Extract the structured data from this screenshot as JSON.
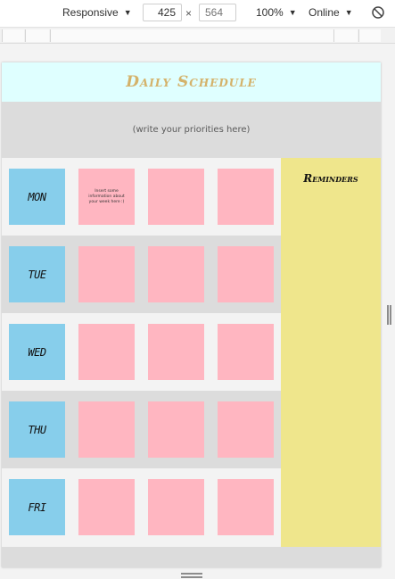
{
  "devtools": {
    "device": "Responsive",
    "width": "425",
    "times": "×",
    "height_placeholder": "564",
    "zoom": "100%",
    "network": "Online"
  },
  "page": {
    "title": "Daily Schedule",
    "priorities_text": "(write your priorities here)",
    "days": [
      {
        "label": "MON",
        "note": "Insert some information about your week here :)"
      },
      {
        "label": "TUE",
        "note": ""
      },
      {
        "label": "WED",
        "note": ""
      },
      {
        "label": "THU",
        "note": ""
      },
      {
        "label": "FRI",
        "note": ""
      }
    ],
    "reminders_title": "Reminders"
  },
  "colors": {
    "header_bg": "#dfffff",
    "title": "#d4b26a",
    "day_box": "#87ceeb",
    "task_box": "#ffb6c1",
    "reminders_bg": "#efe68c",
    "stripe": "#dcdcdc"
  }
}
